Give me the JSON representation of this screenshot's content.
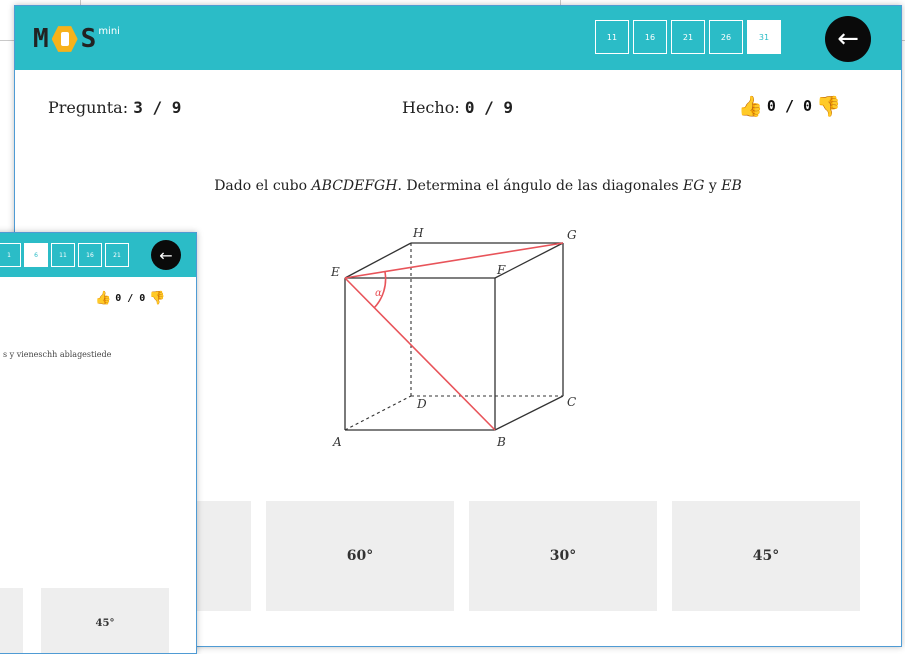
{
  "brand": {
    "logo_left": "M",
    "logo_right": "S",
    "logo_suffix": "mini"
  },
  "front": {
    "tabs": [
      "11",
      "16",
      "21",
      "26",
      "31"
    ],
    "active_tab_index": 4,
    "pregunta_label": "Pregunta:",
    "pregunta_value": "3 / 9",
    "hecho_label": "Hecho:",
    "hecho_value": "0 / 9",
    "votes": "0 / 0",
    "question": {
      "prefix": "Dado el cubo ",
      "cube": "ABCDEFGH",
      "middle": ". Determina el ángulo de las diagonales ",
      "d1": "EG",
      "and": " y ",
      "d2": "EB"
    },
    "figure": {
      "labels": [
        "A",
        "B",
        "C",
        "D",
        "E",
        "F",
        "G",
        "H",
        "α"
      ]
    },
    "answers": [
      "60°",
      "30°",
      "45°"
    ]
  },
  "back": {
    "tabs": [
      "1",
      "6",
      "11",
      "16",
      "21"
    ],
    "active_tab_index": 1,
    "votes": "0 / 0",
    "question_snippet": "s y vieneschh ablagestiede",
    "answer": "45°"
  },
  "colors": {
    "header": "#2bbcc7",
    "answer_bg": "#eeeeee",
    "highlight_line": "#e8545a",
    "thumb_up": "#3aa6d8"
  },
  "icons": [
    "arrow-left-icon",
    "thumbs-up-icon",
    "thumbs-down-icon",
    "hexagon-logo-icon"
  ]
}
